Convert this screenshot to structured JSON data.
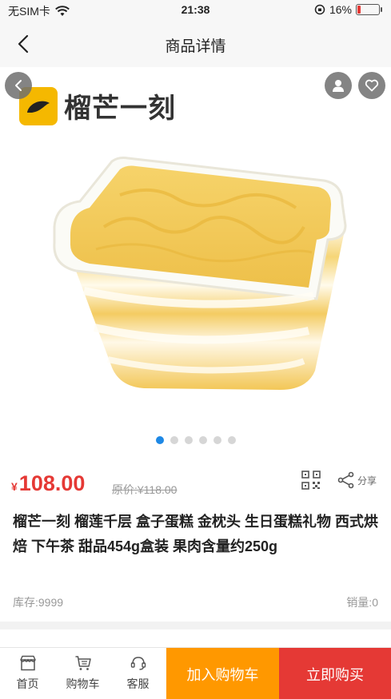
{
  "status_bar": {
    "carrier": "无SIM卡",
    "time": "21:38",
    "battery_percent": "16%",
    "battery_level": 0.16
  },
  "header": {
    "title": "商品详情"
  },
  "gallery": {
    "brand_name": "榴芒一刻",
    "image_count": 6,
    "active_index": 0
  },
  "product": {
    "currency": "¥",
    "price": "108.00",
    "original_price": "原价:¥118.00",
    "share_label": "分享",
    "title": "榴芒一刻 榴莲千层 盒子蛋糕 金枕头 生日蛋糕礼物 西式烘焙 下午茶 甜品454g盒装 果肉含量约250g",
    "stock": "库存:9999",
    "sales": "销量:0"
  },
  "bottom_bar": {
    "home_label": "首页",
    "cart_label": "购物车",
    "service_label": "客服",
    "add_to_cart": "加入购物车",
    "buy_now": "立即购买"
  },
  "colors": {
    "price_red": "#e53935",
    "cart_orange": "#ff9800",
    "buy_red": "#e53935",
    "brand_yellow": "#f5b800",
    "dot_active": "#1e88e5"
  }
}
